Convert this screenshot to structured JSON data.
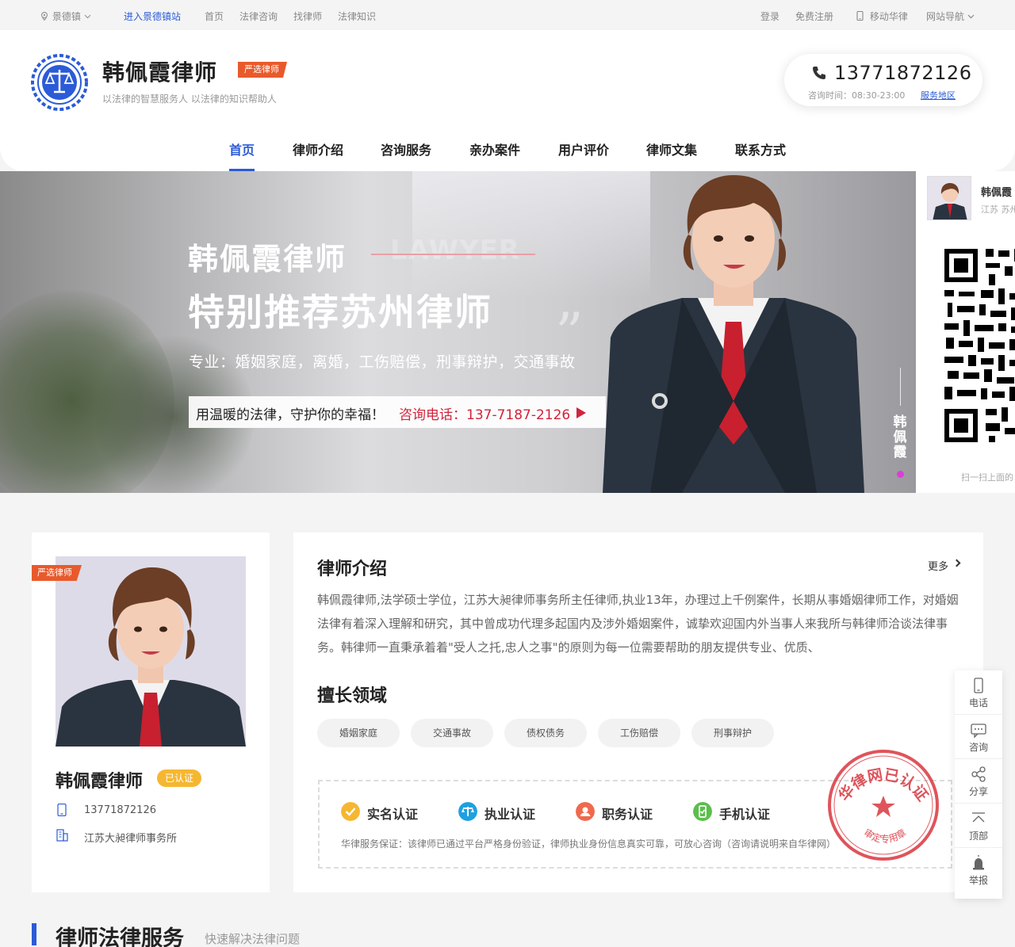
{
  "topbar": {
    "location": "景德镇",
    "enter_site": "进入景德镇站",
    "links": [
      "首页",
      "法律咨询",
      "找律师",
      "法律知识"
    ],
    "login": "登录",
    "register": "免费注册",
    "mobile": "移动华律",
    "site_nav": "网站导航"
  },
  "header": {
    "name": "韩佩霞律师",
    "badge": "严选律师",
    "slogan": "以法律的智慧服务人 以法律的知识帮助人",
    "phone": "13771872126",
    "hours": "咨询时间：08:30-23:00",
    "service_area": "服务地区"
  },
  "nav": {
    "items": [
      "首页",
      "律师介绍",
      "咨询服务",
      "亲办案件",
      "用户评价",
      "律师文集",
      "联系方式"
    ],
    "active": 0
  },
  "hero": {
    "title1": "韩佩霞律师",
    "lawyer_word": "LAWYER",
    "title2": "特别推荐苏州律师",
    "specialty": "专业：婚姻家庭，离婚，工伤赔偿，刑事辩护，交通事故",
    "motto": "用温暖的法律，守护你的幸福！",
    "tel": "咨询电话：137-7187-2126",
    "vertical_name": "韩佩霞"
  },
  "qrpanel": {
    "name": "韩佩霞",
    "location": "江苏 苏州",
    "scan_text": "扫一扫上面的"
  },
  "profile": {
    "badge": "严选律师",
    "name": "韩佩霞律师",
    "verified": "已认证",
    "phone": "13771872126",
    "firm": "江苏大昶律师事务所"
  },
  "intro": {
    "title": "律师介绍",
    "more": "更多",
    "text": "韩佩霞律师,法学硕士学位，江苏大昶律师事务所主任律师,执业13年，办理过上千例案件，长期从事婚姻律师工作，对婚姻法律有着深入理解和研究，其中曾成功代理多起国内及涉外婚姻案件，诚挚欢迎国内外当事人来我所与韩律师洽谈法律事务。韩律师一直秉承着着\"受人之托,忠人之事\"的原则为每一位需要帮助的朋友提供专业、优质、",
    "spec_title": "擅长领域",
    "tags": [
      "婚姻家庭",
      "交通事故",
      "债权债务",
      "工伤赔偿",
      "刑事辩护"
    ],
    "certs": [
      "实名认证",
      "执业认证",
      "职务认证",
      "手机认证"
    ],
    "cert_note": "华律服务保证：该律师已通过平台严格身份验证，律师执业身份信息真实可靠，可放心咨询（咨询请说明来自华律网）",
    "seal_top": "华律网已认证",
    "seal_bottom": "审定专用章"
  },
  "floatbar": {
    "items": [
      "电话",
      "咨询",
      "分享",
      "顶部",
      "举报"
    ]
  },
  "services": {
    "title": "律师法律服务",
    "subtitle": "快速解决法律问题"
  },
  "colors": {
    "accent": "#2b5bd7",
    "badge": "#e85a2c",
    "hero_tel": "#d0243c",
    "verified": "#f5b731",
    "seal": "#d9363e"
  }
}
